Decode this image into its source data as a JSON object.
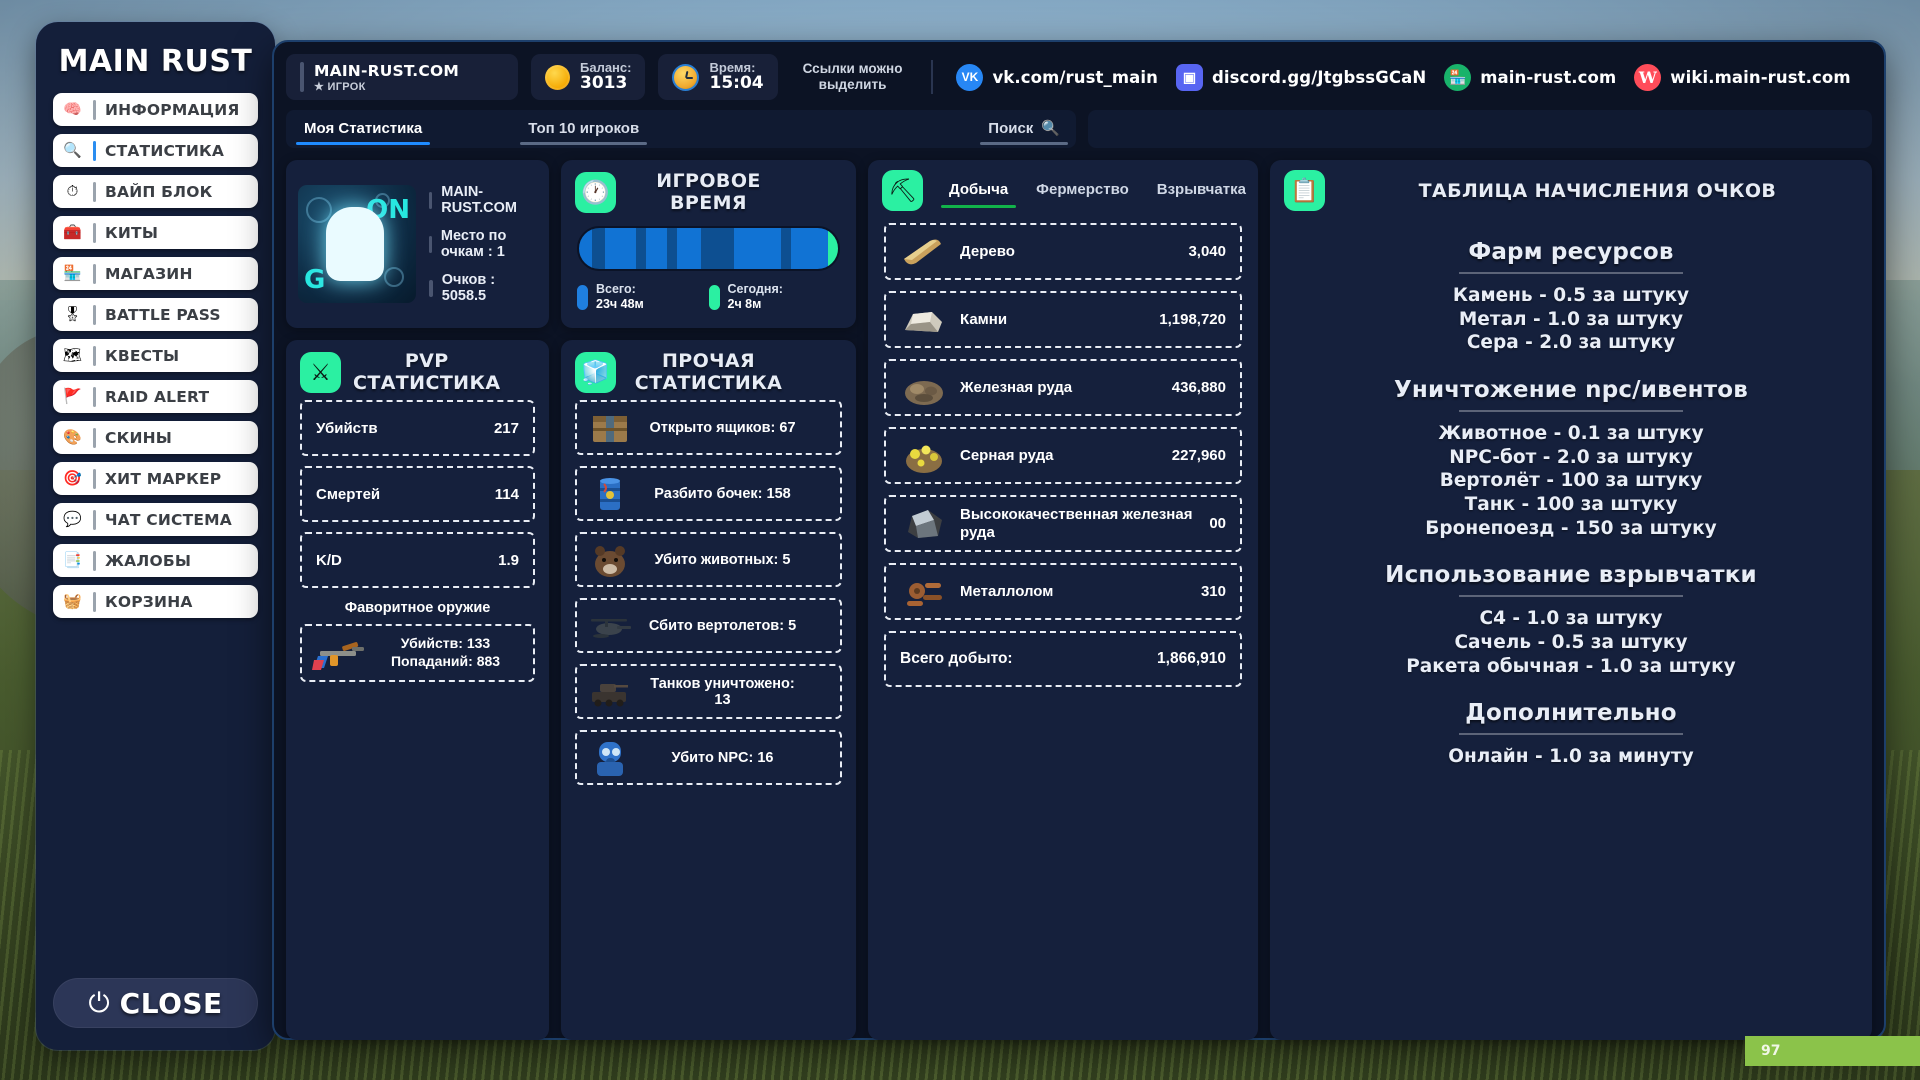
{
  "sidebar": {
    "brand": "MAIN RUST",
    "items": [
      {
        "label": "ИНФОРМАЦИЯ",
        "icon": "brain-icon",
        "glyph": "🧠",
        "active": false
      },
      {
        "label": "СТАТИСТИКА",
        "icon": "magnifier-chart-icon",
        "glyph": "🔍",
        "active": true
      },
      {
        "label": "ВАЙП БЛОК",
        "icon": "timer-icon",
        "glyph": "⏱",
        "active": false
      },
      {
        "label": "КИТЫ",
        "icon": "toolbox-icon",
        "glyph": "🧰",
        "active": false
      },
      {
        "label": "МАГАЗИН",
        "icon": "store-icon",
        "glyph": "🏪",
        "active": false
      },
      {
        "label": "BATTLE PASS",
        "icon": "medal-icon",
        "glyph": "🎖",
        "active": false
      },
      {
        "label": "КВЕСТЫ",
        "icon": "map-scroll-icon",
        "glyph": "🗺",
        "active": false
      },
      {
        "label": "RAID ALERT",
        "icon": "alert-flag-icon",
        "glyph": "🚩",
        "active": false
      },
      {
        "label": "СКИНЫ",
        "icon": "palette-icon",
        "glyph": "🎨",
        "active": false
      },
      {
        "label": "ХИТ МАРКЕР",
        "icon": "crosshair-icon",
        "glyph": "🎯",
        "active": false
      },
      {
        "label": "ЧАТ СИСТЕМА",
        "icon": "chat-bubble-icon",
        "glyph": "💬",
        "active": false
      },
      {
        "label": "ЖАЛОБЫ",
        "icon": "report-icon",
        "glyph": "📑",
        "active": false
      },
      {
        "label": "КОРЗИНА",
        "icon": "basket-icon",
        "glyph": "🧺",
        "active": false
      }
    ],
    "close_label": "CLOSE",
    "close_icon": "power-icon"
  },
  "topbar": {
    "server_name": "MAIN-RUST.COM",
    "server_role": "★ ИГРОК",
    "balance_label": "Баланс:",
    "balance_value": "3013",
    "balance_icon": "coin-icon",
    "time_label": "Время:",
    "time_value": "15:04",
    "time_icon": "clock-icon",
    "hint_line1": "Ссылки можно",
    "hint_line2": "выделить",
    "links": [
      {
        "label": "vk.com/rust_main",
        "icon": "vk-icon",
        "glyph": "VK",
        "color": "#2787f5"
      },
      {
        "label": "discord.gg/JtgbssGCaN",
        "icon": "discord-icon",
        "glyph": "▣",
        "color": "#5865f2"
      },
      {
        "label": "main-rust.com",
        "icon": "shop-icon",
        "glyph": "🏪",
        "color": "#19b36b"
      },
      {
        "label": "wiki.main-rust.com",
        "icon": "wikipedia-icon",
        "glyph": "W",
        "color": "#ff4d5a"
      }
    ]
  },
  "tabs": {
    "my_stats": "Моя Статистика",
    "top_players": "Топ 10 игроков",
    "search": "Поиск",
    "search_icon": "search-icon"
  },
  "profile": {
    "avatar_name": "player-avatar",
    "avatar_tag_top": "ON",
    "avatar_tag_bottom": "G",
    "server": "MAIN-RUST.COM",
    "rank_line": "Место по очкам : 1",
    "points_line": "Очков : 5058.5"
  },
  "playtime": {
    "title": "ИГРОВОЕ ВРЕМЯ",
    "icon": "clock-panel-icon",
    "total_label": "Всего:",
    "total_value": "23ч 48м",
    "today_label": "Сегодня:",
    "today_value": "2ч 8м",
    "total_color": "#1f7fe0",
    "today_color": "#2bf0a2",
    "segments": [
      {
        "w": 5,
        "c": "#1173d4"
      },
      {
        "w": 5,
        "c": "#0d4f91"
      },
      {
        "w": 12,
        "c": "#1173d4"
      },
      {
        "w": 4,
        "c": "#0d4f91"
      },
      {
        "w": 8,
        "c": "#1173d4"
      },
      {
        "w": 4,
        "c": "#0d4f91"
      },
      {
        "w": 9,
        "c": "#1173d4"
      },
      {
        "w": 13,
        "c": "#0d4f91"
      },
      {
        "w": 18,
        "c": "#1173d4"
      },
      {
        "w": 4,
        "c": "#0d4f91"
      },
      {
        "w": 14,
        "c": "#1173d4"
      },
      {
        "w": 4,
        "c": "#2bf0a2"
      }
    ]
  },
  "pvp": {
    "title": "PVP СТАТИСТИКА",
    "icon": "crossed-swords-icon",
    "rows": [
      {
        "name": "Убийств",
        "value": "217"
      },
      {
        "name": "Смертей",
        "value": "114"
      },
      {
        "name": "K/D",
        "value": "1.9"
      }
    ],
    "fav_title": "Фаворитное оружие",
    "fav_icon": "assault-rifle-icon",
    "fav_kills": "Убийств: 133",
    "fav_hits": "Попаданий: 883"
  },
  "other": {
    "title": "ПРОЧАЯ СТАТИСТИКА",
    "icon": "boxes-icon",
    "rows": [
      {
        "text": "Открыто ящиков: 67",
        "icon": "crate-icon"
      },
      {
        "text": "Разбито бочек: 158",
        "icon": "barrel-icon"
      },
      {
        "text": "Убито животных: 5",
        "icon": "bear-icon"
      },
      {
        "text": "Сбито вертолетов: 5",
        "icon": "helicopter-icon"
      },
      {
        "text": "Танков уничтожено: 13",
        "icon": "tank-icon"
      },
      {
        "text": "Убито NPC: 16",
        "icon": "npc-scientist-icon"
      }
    ]
  },
  "resources": {
    "icon": "pickaxe-icon",
    "tabs": [
      {
        "label": "Добыча",
        "active": true
      },
      {
        "label": "Фермерство",
        "active": false
      },
      {
        "label": "Взрывчатка",
        "active": false
      }
    ],
    "rows": [
      {
        "name": "Дерево",
        "value": "3,040",
        "icon": "wood-icon"
      },
      {
        "name": "Камни",
        "value": "1,198,720",
        "icon": "stone-icon"
      },
      {
        "name": "Железная руда",
        "value": "436,880",
        "icon": "metal-ore-icon"
      },
      {
        "name": "Серная руда",
        "value": "227,960",
        "icon": "sulfur-ore-icon"
      },
      {
        "name": "Высококачественная железная руда",
        "value": "00",
        "icon": "hqm-ore-icon"
      },
      {
        "name": "Металлолом",
        "value": "310",
        "icon": "scrap-icon"
      }
    ],
    "total_label": "Всего добыто:",
    "total_value": "1,866,910"
  },
  "points_table": {
    "title": "ТАБЛИЦА НАЧИСЛЕНИЯ ОЧКОВ",
    "icon": "clipboard-icon",
    "sections": [
      {
        "heading": "Фарм ресурсов",
        "lines": [
          "Камень - 0.5 за штуку",
          "Метал - 1.0 за штуку",
          "Сера - 2.0 за штуку"
        ]
      },
      {
        "heading": "Уничтожение npc/ивентов",
        "lines": [
          "Животное - 0.1 за штуку",
          "NPC-бот - 2.0 за штуку",
          "Вертолёт - 100 за штуку",
          "Танк - 100 за штуку",
          "Бронепоезд - 150 за штуку"
        ]
      },
      {
        "heading": "Использование взрывчатки",
        "lines": [
          "C4 - 1.0 за штуку",
          "Сачель - 0.5 за штуку",
          "Ракета обычная - 1.0 за штуку"
        ]
      },
      {
        "heading": "Дополнительно",
        "lines": [
          "Онлайн - 1.0 за минуту"
        ]
      }
    ]
  },
  "hud": {
    "value": "97",
    "color": "#8bc34a"
  }
}
